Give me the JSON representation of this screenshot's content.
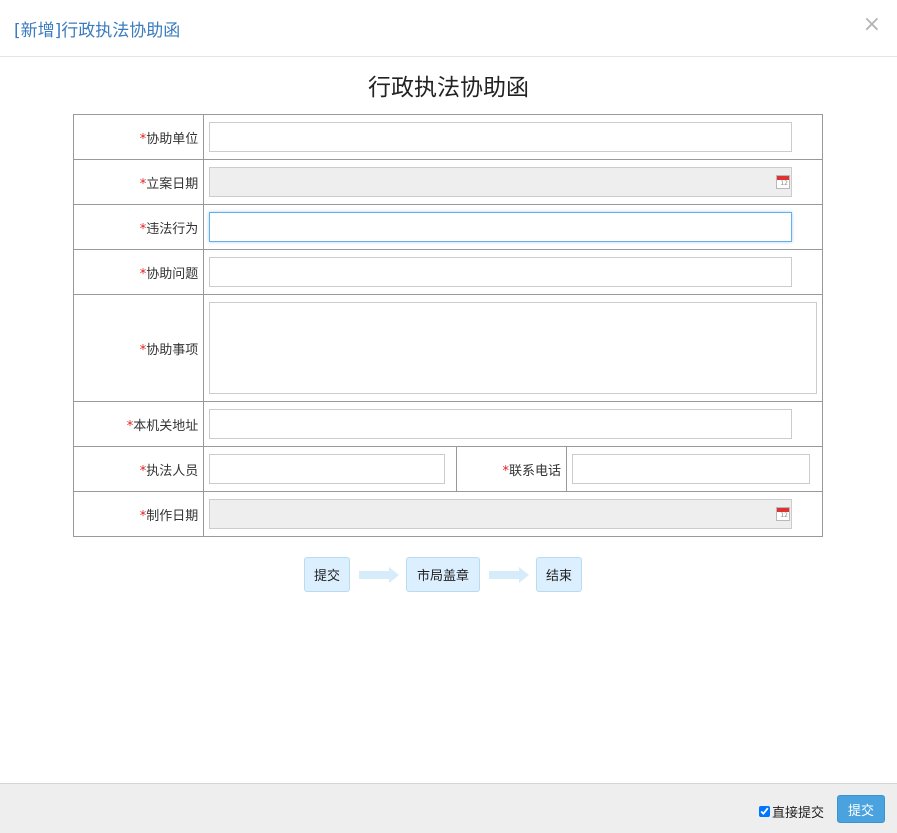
{
  "modal": {
    "title": "[新增]行政执法协助函",
    "close_icon": "×"
  },
  "form": {
    "title": "行政执法协助函",
    "required_mark": "*",
    "fields": {
      "assist_unit": {
        "label": "协助单位",
        "value": ""
      },
      "filing_date": {
        "label": "立案日期",
        "value": ""
      },
      "violation": {
        "label": "违法行为",
        "value": ""
      },
      "assist_issue": {
        "label": "协助问题",
        "value": ""
      },
      "assist_matters": {
        "label": "协助事项",
        "value": ""
      },
      "agency_address": {
        "label": "本机关地址",
        "value": ""
      },
      "enforcer": {
        "label": "执法人员",
        "value": ""
      },
      "phone": {
        "label": "联系电话",
        "value": ""
      },
      "made_date": {
        "label": "制作日期",
        "value": ""
      }
    },
    "calendar_icon_text": "12"
  },
  "workflow": {
    "steps": [
      "提交",
      "市局盖章",
      "结束"
    ]
  },
  "footer": {
    "direct_submit_label": "直接提交",
    "direct_submit_checked": true,
    "submit_label": "提交"
  },
  "colors": {
    "title_blue": "#3b7bbf",
    "required_red": "#e02020",
    "step_bg": "#dcefff",
    "submit_bg": "#4aa3df"
  }
}
